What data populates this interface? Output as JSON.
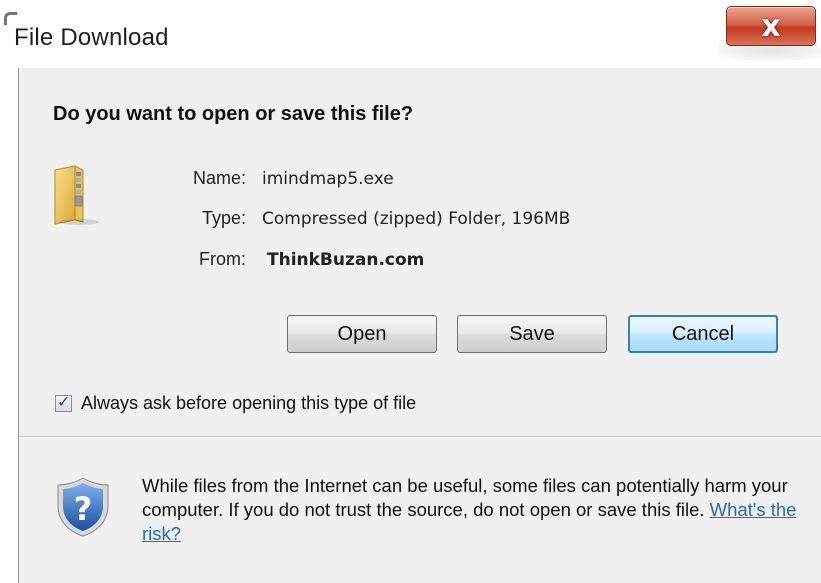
{
  "window": {
    "title": "File Download",
    "close_glyph": "x"
  },
  "dialog": {
    "question": "Do you want to open or save this file?",
    "file_icon": "zip-folder-icon",
    "fields": {
      "name_label": "Name:",
      "name_value": "imindmap5.exe",
      "type_label": "Type:",
      "type_value": "Compressed (zipped) Folder, 196MB",
      "from_label": "From:",
      "from_value": "ThinkBuzan.com"
    },
    "buttons": {
      "open_label": "Open",
      "save_label": "Save",
      "cancel_label": "Cancel"
    },
    "checkbox": {
      "checked": true,
      "label": "Always ask before opening this type of file"
    },
    "warning": {
      "icon": "security-shield-icon",
      "text": "While files from the Internet can be useful, some files can potentially harm your computer. If you do not trust the source, do not open or save this file.",
      "link_text": "What's the risk?"
    }
  },
  "colors": {
    "link": "#1c6ec9",
    "close_button": "#c2391e",
    "default_button_border": "#3c7fb1",
    "panel_background": "#f0f0f0"
  }
}
